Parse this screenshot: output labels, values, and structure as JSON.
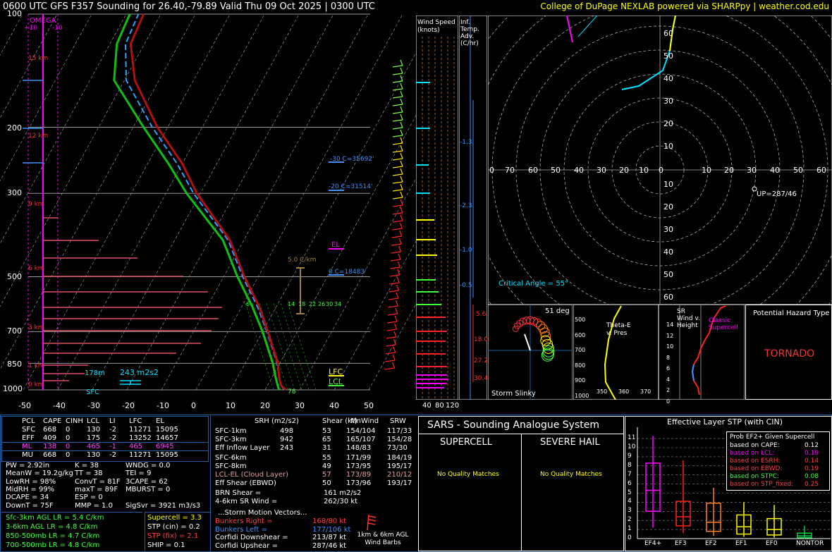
{
  "header": {
    "title": "0600 UTC GFS F357 Sounding for 26.40,-79.89 Valid  Thu 09 Oct 2025 | 0300 UTC",
    "credit": "College of DuPage NEXLAB powered via SHARPpy | weather.cod.edu"
  },
  "colors": {
    "temp": "#b01010",
    "dewp": "#10c010",
    "wetbulb": "#30a0ff",
    "border": "#2060a0"
  },
  "skewt": {
    "pressure_ticks": [
      "100",
      "200",
      "300",
      "500",
      "700",
      "850",
      "1000"
    ],
    "temp_ticks": [
      "-50",
      "-40",
      "-30",
      "-20",
      "-10",
      "0",
      "10",
      "20",
      "30",
      "40",
      "50"
    ],
    "height_labels": [
      "15 km",
      "12 km",
      "9 km",
      "6 km",
      "3 km",
      "1 km",
      "0 km"
    ],
    "omega_label": "OMEGA",
    "omega_ticks": [
      "+10",
      "-10"
    ],
    "annotations": {
      "m30": "-30 C=35692'",
      "m20": "-20 C=31514'",
      "zero": "0 C=18483'",
      "lapse": "5.0 C/km",
      "el": "EL",
      "lfc": "LFC",
      "lcl": "LCL",
      "sfc": "SFC",
      "esrh_height": "178m",
      "esrh": "243 m2s2",
      "sfc_temp": "78"
    },
    "mixing_ratios": [
      "6",
      "14",
      "18",
      "22",
      "26",
      "30",
      "34"
    ]
  },
  "chart_data": {
    "type": "line",
    "title": "Skew-T Log-P sounding",
    "xlabel": "",
    "ylabel": "",
    "y_scale": "log",
    "ylim": [
      1000,
      100
    ],
    "xlim": [
      -50,
      50
    ],
    "series": [
      {
        "name": "",
        "pressure": [
          1000,
          975,
          925,
          850,
          700,
          600,
          500,
          400,
          300,
          250,
          200,
          150,
          120,
          100
        ],
        "temp": [
          26.0,
          24.0,
          22.0,
          19.5,
          11.5,
          5.0,
          -4.0,
          -14.0,
          -31.0,
          -40.0,
          -53.0,
          -67.0,
          -74.0,
          -75.0
        ]
      },
      {
        "name": "",
        "pressure": [
          1000,
          975,
          925,
          850,
          700,
          600,
          500,
          400,
          300,
          250,
          200,
          150,
          120,
          100
        ],
        "dewp": [
          24.0,
          23.0,
          21.0,
          18.0,
          10.0,
          3.0,
          -6.0,
          -16.0,
          -34.0,
          -44.0,
          -57.0,
          -73.0,
          -78.0,
          -79.0
        ]
      }
    ]
  },
  "wind_speed_panel": {
    "title": "Wind Speed (knots)",
    "ticks": [
      "40",
      "80",
      "120"
    ]
  },
  "inferred_panel": {
    "title": "Inf. Temp. Adv. (C/hr)",
    "values": [
      "-1.3",
      "-2.3",
      "-1.0",
      "-0.5",
      "5.6",
      "18.0",
      "27.2",
      "30.4"
    ]
  },
  "hodograph": {
    "x_ticks": [
      "0",
      "70",
      "60",
      "50",
      "40",
      "30",
      "20",
      "10",
      "0",
      "10",
      "20",
      "30",
      "40",
      "50",
      "60",
      "70"
    ],
    "y_ticks_up": [
      "60",
      "50",
      "40",
      "30",
      "20",
      "10"
    ],
    "y_ticks_down": [
      "10",
      "20",
      "30",
      "40",
      "50",
      "60"
    ],
    "critical_angle": "Critical Angle = 55°",
    "up": "UP=287/46"
  },
  "slinky": {
    "label": "Storm Slinky",
    "deg": "51 deg"
  },
  "theta_e": {
    "title": "Theta-E v. Pres",
    "p_ticks": [
      "500",
      "600",
      "700",
      "800",
      "900",
      "1000"
    ],
    "x_ticks": [
      "350",
      "360",
      "370"
    ]
  },
  "srwind": {
    "title": "SR Wind v. Height",
    "h_ticks": [
      "14",
      "12",
      "10",
      "8",
      "6",
      "4",
      "2",
      "0"
    ],
    "classic": "Classic Supercell"
  },
  "hazard": {
    "title": "Potential Hazard Type",
    "value": "TORNADO"
  },
  "parcel_table": {
    "headers": [
      "PCL",
      "CAPE",
      "CINH",
      "LCL",
      "LI",
      "LFC",
      "EL"
    ],
    "rows": [
      [
        "SFC",
        "668",
        "0",
        "130",
        "-2",
        "11271",
        "15095"
      ],
      [
        "EFF",
        "409",
        "0",
        "175",
        "-2",
        "13252",
        "14657"
      ],
      [
        "ML",
        "138",
        "0",
        "465",
        "-1",
        "465",
        "6945"
      ],
      [
        "MU",
        "668",
        "0",
        "130",
        "-2",
        "11271",
        "15095"
      ]
    ]
  },
  "indices": [
    [
      "PW = 2.92in",
      "K = 38",
      "WNDG = 0.0"
    ],
    [
      "MeanW = 19.2g/kg",
      "TT = 38",
      "TEI = 9"
    ],
    [
      "LowRH = 98%",
      "ConvT = 81F",
      "3CAPE = 62"
    ],
    [
      "MidRH = 99%",
      "maxT = 89F",
      "MBURST = 0"
    ],
    [
      "DCAPE = 34",
      "ESP = 0",
      ""
    ],
    [
      "DownT = 75F",
      "MMP = 1.0",
      "SigSvr = 3921 m3/s3"
    ]
  ],
  "lapse_rates": [
    "Sfc-3km AGL LR = 5.4 C/km",
    "3-6km AGL LR = 4.8 C/km",
    "850-500mb LR = 4.7 C/km",
    "700-500mb LR = 4.8 C/km"
  ],
  "composite": [
    "Supercell = 3.3",
    "STP (cin) = 0.2",
    "STP (fix) = 2.1",
    "SHIP = 0.1"
  ],
  "kinematics": {
    "headers": [
      "SRH (m2/s2)",
      "Shear (kt)",
      "MnWind",
      "SRW"
    ],
    "rows1": [
      [
        "SFC-1km",
        "498",
        "53",
        "154/104",
        "117/33"
      ],
      [
        "SFC-3km",
        "942",
        "65",
        "165/107",
        "154/28"
      ],
      [
        "Eff Inflow Layer",
        "243",
        "31",
        "148/83",
        "73/30"
      ]
    ],
    "rows2": [
      [
        "SFC-6km",
        "",
        "55",
        "171/99",
        "184/19"
      ],
      [
        "SFC-8km",
        "",
        "49",
        "173/95",
        "195/17"
      ],
      [
        "LCL-EL (Cloud Layer)",
        "",
        "57",
        "173/89",
        "210/12"
      ],
      [
        "Eff Shear (EBWD)",
        "",
        "50",
        "173/96",
        "193/17"
      ]
    ],
    "brn": [
      "BRN Shear =",
      "161 m2/s2"
    ],
    "srwind46": [
      "4-6km SR Wind =",
      "262/30 kt"
    ],
    "storm_motion_title": "...Storm Motion Vectors...",
    "motions": [
      [
        "Bunkers Right =",
        "168/80 kt"
      ],
      [
        "Bunkers Left =",
        "177/106 kt"
      ],
      [
        "Corfidi Downshear =",
        "213/87 kt"
      ],
      [
        "Corfidi Upshear =",
        "287/46 kt"
      ]
    ],
    "barb_label": "1km & 6km AGL Wind Barbs"
  },
  "sars": {
    "title": "SARS - Sounding Analogue System",
    "supercell": "SUPERCELL",
    "hail": "SEVERE HAIL",
    "no_match": "No Quality Matches"
  },
  "stp": {
    "title": "Effective Layer STP (with CIN)",
    "y_ticks": [
      "0",
      "1",
      "2",
      "3",
      "4",
      "5",
      "6",
      "7",
      "8",
      "9",
      "10",
      "11"
    ],
    "categories": [
      "EF4+",
      "EF3",
      "EF2",
      "EF1",
      "EF0",
      "NONTOR"
    ],
    "legend_title": "Prob EF2+ Given Supercell",
    "legend": [
      [
        "based on CAPE:",
        "0.12"
      ],
      [
        "based on LCL:",
        "0.19"
      ],
      [
        "based on ESRH:",
        "0.14"
      ],
      [
        "based on EBWD:",
        "0.19"
      ],
      [
        "based on STPC:",
        "0.08"
      ],
      [
        "based on STP_fixed:",
        "0.25"
      ]
    ]
  }
}
